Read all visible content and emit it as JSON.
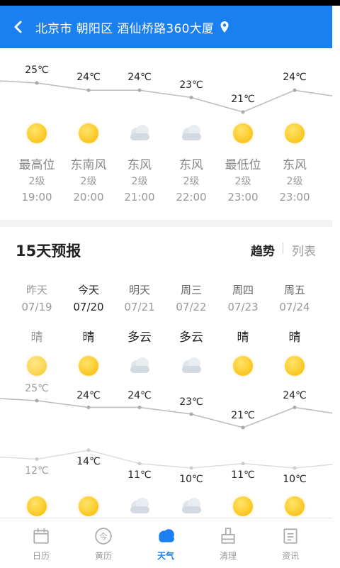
{
  "header": {
    "location": "北京市 朝阳区 酒仙桥路360大厦"
  },
  "hourly": [
    {
      "temp": "25℃",
      "icon": "sun-icon",
      "label": "最高位",
      "level": "2级",
      "time": "19:00"
    },
    {
      "temp": "24℃",
      "icon": "sun-icon",
      "label": "东南风",
      "level": "2级",
      "time": "20:00"
    },
    {
      "temp": "24℃",
      "icon": "cloud-icon",
      "label": "东风",
      "level": "2级",
      "time": "21:00"
    },
    {
      "temp": "23℃",
      "icon": "cloud-icon",
      "label": "东风",
      "level": "2级",
      "time": "22:00"
    },
    {
      "temp": "21℃",
      "icon": "sun-icon",
      "label": "最低位",
      "level": "2级",
      "time": "23:00"
    },
    {
      "temp": "24℃",
      "icon": "sun-icon",
      "label": "东风",
      "level": "2级",
      "time": "23:00"
    }
  ],
  "forecast": {
    "title": "15天预报",
    "mode_trend": "趋势",
    "mode_list": "列表",
    "days": [
      {
        "name": "昨天",
        "date": "07/19",
        "cond": "晴",
        "icon": "sun-icon",
        "high": "25℃",
        "low": "12℃",
        "night_icon": "sun-icon"
      },
      {
        "name": "今天",
        "date": "07/20",
        "cond": "晴",
        "icon": "sun-icon",
        "high": "24℃",
        "low": "14℃",
        "night_icon": "sun-icon"
      },
      {
        "name": "明天",
        "date": "07/21",
        "cond": "多云",
        "icon": "cloud-icon",
        "high": "24℃",
        "low": "11℃",
        "night_icon": "cloud-icon"
      },
      {
        "name": "周三",
        "date": "07/22",
        "cond": "多云",
        "icon": "cloud-icon",
        "high": "23℃",
        "low": "10℃",
        "night_icon": "cloud-icon"
      },
      {
        "name": "周四",
        "date": "07/23",
        "cond": "晴",
        "icon": "sun-icon",
        "high": "21℃",
        "low": "11℃",
        "night_icon": "sun-icon"
      },
      {
        "name": "周五",
        "date": "07/24",
        "cond": "晴",
        "icon": "sun-icon",
        "high": "24℃",
        "low": "10℃",
        "night_icon": "sun-icon"
      }
    ]
  },
  "nav": [
    {
      "label": "日历",
      "icon": "calendar-icon",
      "active": false
    },
    {
      "label": "黄历",
      "icon": "almanac-icon",
      "active": false
    },
    {
      "label": "天气",
      "icon": "weather-cloud-icon",
      "active": true
    },
    {
      "label": "清理",
      "icon": "clean-icon",
      "active": false
    },
    {
      "label": "资讯",
      "icon": "news-icon",
      "active": false
    }
  ],
  "colors": {
    "accent": "#1a7ff0",
    "sun": "#f7b900",
    "cloud": "#d6dde6",
    "line": "#bbbbbb"
  }
}
